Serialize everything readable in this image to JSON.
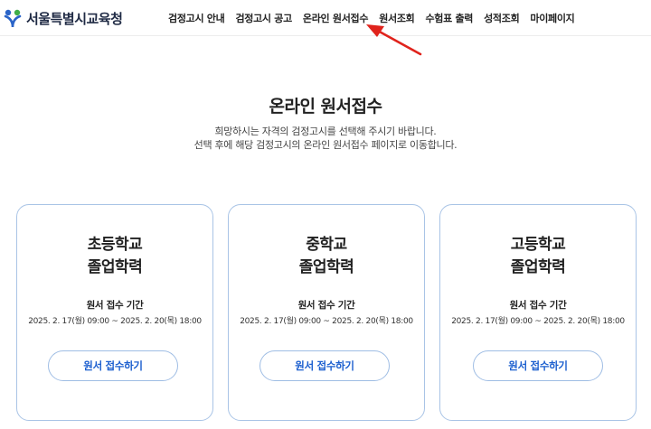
{
  "header": {
    "logo_text": "서울특별시교육청",
    "nav": [
      {
        "label": "검정고시 안내"
      },
      {
        "label": "검정고시 공고"
      },
      {
        "label": "온라인 원서접수"
      },
      {
        "label": "원서조회"
      },
      {
        "label": "수험표 출력"
      },
      {
        "label": "성적조회"
      },
      {
        "label": "마이페이지"
      }
    ]
  },
  "main": {
    "title": "온라인 원서접수",
    "description_line1": "희망하시는 자격의 검정고시를 선택해 주시기 바랍니다.",
    "description_line2": "선택 후에 해당 검정고시의 온라인 원서접수 페이지로 이동합니다."
  },
  "cards": [
    {
      "title_line1": "초등학교",
      "title_line2": "졸업학력",
      "period_label": "원서 접수 기간",
      "period": "2025. 2. 17(월) 09:00 ~ 2025. 2. 20(목) 18:00",
      "button": "원서 접수하기"
    },
    {
      "title_line1": "중학교",
      "title_line2": "졸업학력",
      "period_label": "원서 접수 기간",
      "period": "2025. 2. 17(월) 09:00 ~ 2025. 2. 20(목) 18:00",
      "button": "원서 접수하기"
    },
    {
      "title_line1": "고등학교",
      "title_line2": "졸업학력",
      "period_label": "원서 접수 기간",
      "period": "2025. 2. 17(월) 09:00 ~ 2025. 2. 20(목) 18:00",
      "button": "원서 접수하기"
    }
  ],
  "colors": {
    "accent": "#1c5fcf",
    "card_border": "#a9c4e6",
    "annotation_arrow": "#e0231c",
    "logo_blue": "#2a64c8",
    "logo_green": "#3fae49"
  },
  "icons": {
    "logo": "seoul-education-logo-icon",
    "annotation": "red-arrow-icon"
  }
}
